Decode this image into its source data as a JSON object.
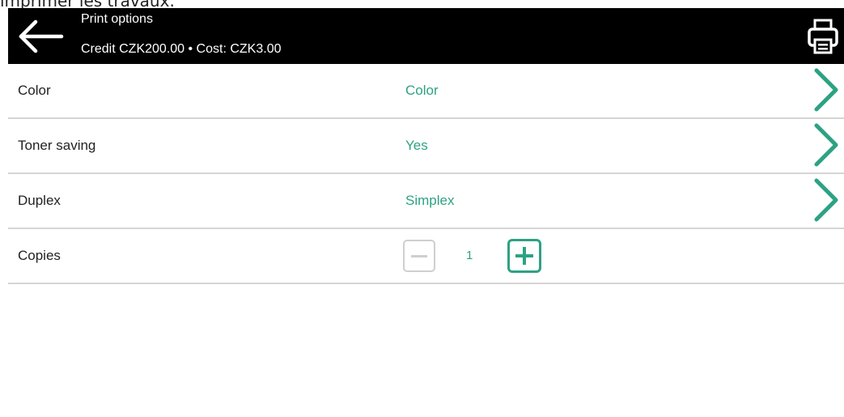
{
  "background_caption": "imprimer les travaux.",
  "header": {
    "title": "Print options",
    "subtitle": "Credit CZK200.00 • Cost: CZK3.00",
    "back_icon": "back-arrow-icon",
    "print_icon": "printer-icon"
  },
  "options": [
    {
      "label": "Color",
      "value": "Color"
    },
    {
      "label": "Toner saving",
      "value": "Yes"
    },
    {
      "label": "Duplex",
      "value": "Simplex"
    }
  ],
  "copies": {
    "label": "Copies",
    "value": "1"
  },
  "colors": {
    "accent": "#2da283",
    "header_bg": "#000000",
    "divider": "#d5d5d5",
    "disabled": "#cfcfcf"
  }
}
